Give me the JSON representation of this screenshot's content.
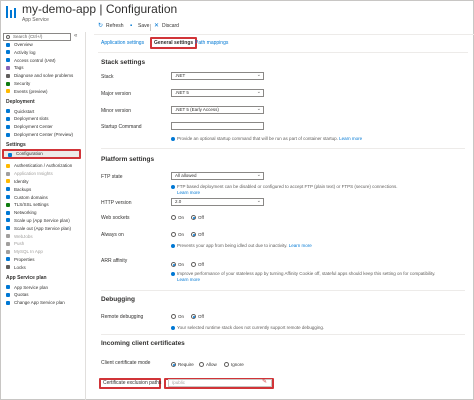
{
  "header": {
    "title": "my-demo-app | Configuration",
    "subtitle": "App Service"
  },
  "sidebar": {
    "search_placeholder": "Search (Ctrl+/)",
    "collapse_glyph": "«",
    "top_items": [
      {
        "label": "Overview",
        "icon": "globe-icon",
        "color": "#0078d4"
      },
      {
        "label": "Activity log",
        "icon": "list-icon",
        "color": "#0078d4"
      },
      {
        "label": "Access control (IAM)",
        "icon": "people-icon",
        "color": "#0078d4"
      },
      {
        "label": "Tags",
        "icon": "tag-icon",
        "color": "#8764b8"
      },
      {
        "label": "Diagnose and solve problems",
        "icon": "wrench-icon",
        "color": "#605e5c"
      },
      {
        "label": "Security",
        "icon": "shield-icon",
        "color": "#107c10"
      },
      {
        "label": "Events (preview)",
        "icon": "bolt-icon",
        "color": "#ffb900"
      }
    ],
    "deployment_header": "Deployment",
    "deployment_items": [
      {
        "label": "Quickstart",
        "icon": "cloud-icon",
        "color": "#0078d4"
      },
      {
        "label": "Deployment slots",
        "icon": "slots-icon",
        "color": "#0078d4"
      },
      {
        "label": "Deployment Center",
        "icon": "cube-icon",
        "color": "#0078d4"
      },
      {
        "label": "Deployment Center (Preview)",
        "icon": "cube-icon",
        "color": "#0078d4"
      }
    ],
    "settings_header": "Settings",
    "settings_items": [
      {
        "label": "Configuration",
        "icon": "bars-icon",
        "color": "#0078d4",
        "selected": true
      },
      {
        "label": "Authentication / Authorization",
        "icon": "key-icon",
        "color": "#ffb900"
      },
      {
        "label": "Application Insights",
        "icon": "bulb-icon",
        "color": "#a19f9d",
        "dim": true
      },
      {
        "label": "Identity",
        "icon": "id-icon",
        "color": "#ffb900"
      },
      {
        "label": "Backups",
        "icon": "backup-icon",
        "color": "#0078d4"
      },
      {
        "label": "Custom domains",
        "icon": "domain-icon",
        "color": "#0078d4"
      },
      {
        "label": "TLS/SSL settings",
        "icon": "lock-icon",
        "color": "#107c10"
      },
      {
        "label": "Networking",
        "icon": "network-icon",
        "color": "#0078d4"
      },
      {
        "label": "Scale up (App Service plan)",
        "icon": "scale-up-icon",
        "color": "#0078d4"
      },
      {
        "label": "Scale out (App Service plan)",
        "icon": "scale-out-icon",
        "color": "#0078d4"
      },
      {
        "label": "WebJobs",
        "icon": "webjobs-icon",
        "color": "#a19f9d",
        "dim": true
      },
      {
        "label": "Push",
        "icon": "push-icon",
        "color": "#a19f9d",
        "dim": true
      },
      {
        "label": "MySQL In App",
        "icon": "mysql-icon",
        "color": "#a19f9d",
        "dim": true
      },
      {
        "label": "Properties",
        "icon": "properties-icon",
        "color": "#0078d4"
      },
      {
        "label": "Locks",
        "icon": "lock-icon",
        "color": "#605e5c"
      }
    ],
    "plan_header": "App Service plan",
    "plan_items": [
      {
        "label": "App Service plan",
        "icon": "plan-icon",
        "color": "#0078d4"
      },
      {
        "label": "Quotas",
        "icon": "quota-icon",
        "color": "#0078d4"
      },
      {
        "label": "Change App Service plan",
        "icon": "change-icon",
        "color": "#0078d4"
      }
    ]
  },
  "toolbar": {
    "refresh": "Refresh",
    "save": "Save",
    "discard": "Discard"
  },
  "tabs": [
    "Application settings",
    "General settings",
    "Path mappings"
  ],
  "stack": {
    "title": "Stack settings",
    "stack_label": "Stack",
    "stack_value": ".NET",
    "major_label": "Major version",
    "major_value": ".NET 5",
    "minor_label": "Minor version",
    "minor_value": ".NET 5 (Early Access)",
    "startup_label": "Startup Command",
    "startup_info": "Provide an optional startup command that will be run as part of container startup.",
    "learn_more": "Learn more"
  },
  "platform": {
    "title": "Platform settings",
    "ftp_label": "FTP state",
    "ftp_value": "All allowed",
    "ftp_info_1": "FTP based deployment can be disabled or configured to accept FTP (plain text) or FTPS (secure) connections.",
    "learn_more": "Learn more",
    "http_label": "HTTP version",
    "http_value": "2.0",
    "ws_label": "Web sockets",
    "ws_on": "On",
    "ws_off": "Off",
    "alwayson_label": "Always on",
    "alwayson_on": "On",
    "alwayson_off": "Off",
    "alwayson_info": "Prevents your app from being idled out due to inactivity.",
    "arr_label": "ARR affinity",
    "arr_on": "On",
    "arr_off": "Off",
    "arr_info_1": "Improve performance of your stateless app by turning Affinity Cookie off, stateful apps should keep this setting on for compatibility.",
    "arr_learn_more": "Learn more"
  },
  "debugging": {
    "title": "Debugging",
    "remote_label": "Remote debugging",
    "remote_on": "On",
    "remote_off": "Off",
    "remote_info": "Your selected runtime stack does not currently support remote debugging."
  },
  "certs": {
    "title": "Incoming client certificates",
    "mode_label": "Client certificate mode",
    "mode_require": "Require",
    "mode_allow": "Allow",
    "mode_ignore": "Ignore",
    "excl_label": "Certificate exclusion paths",
    "excl_placeholder": "/public"
  },
  "colors": {
    "accent": "#0078d4",
    "highlight": "#d13438"
  }
}
